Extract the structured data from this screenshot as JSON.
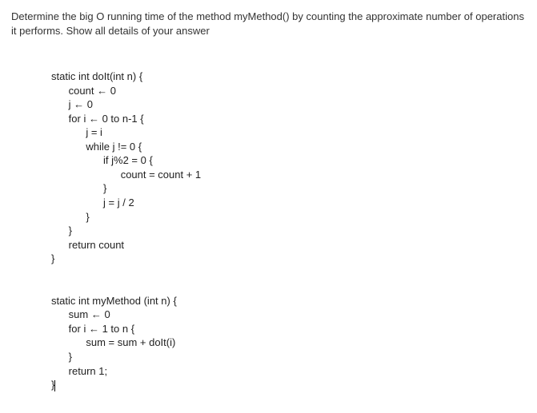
{
  "instructions": "Determine the big O running time of the method myMethod() by counting the approximate number of operations it performs. Show all details of your answer",
  "code": {
    "doIt": {
      "sig": "static int doIt(int n) {",
      "l1": "count ← 0",
      "l2": "j ← 0",
      "l3": "for i ← 0 to n-1 {",
      "l4": "j = i",
      "l5": "while j != 0 {",
      "l6": "if j%2 = 0 {",
      "l7": "count = count + 1",
      "l8": "}",
      "l9": "j = j / 2",
      "l10": "}",
      "l11": "}",
      "l12": "return count",
      "l13": "}"
    },
    "myMethod": {
      "sig": "static int myMethod (int n) {",
      "l1": "sum ← 0",
      "l2": "for i ← 1 to n {",
      "l3": "sum = sum + doIt(i)",
      "l4": "}",
      "l5": "return 1;",
      "l6": "}"
    }
  }
}
